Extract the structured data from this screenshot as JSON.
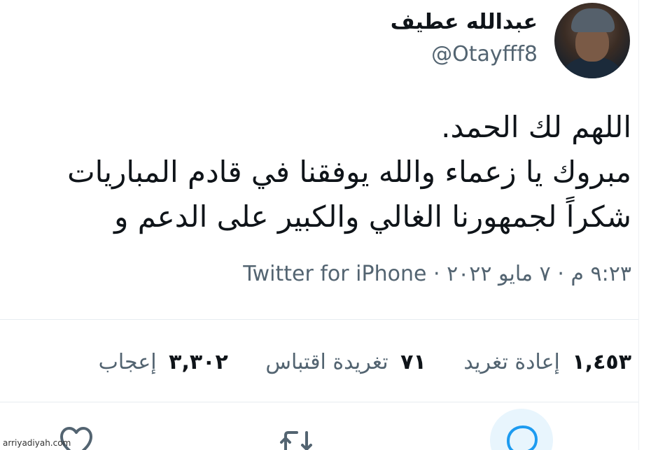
{
  "author": {
    "display_name": "عبدالله عطيف",
    "handle": "@Otayfff8"
  },
  "tweet": {
    "lines": [
      "اللهم لك الحمد.",
      "مبروك يا زعماء والله يوفقنا في قادم المباريات",
      "شكراً لجمهورنا الغالي والكبير على الدعم و"
    ]
  },
  "meta": {
    "time": "٩:٢٣ م",
    "separator": "·",
    "date": "٧ مايو ٢٠٢٢",
    "source": "Twitter for iPhone"
  },
  "stats": {
    "retweets": {
      "count": "١,٤٥٣",
      "label": "إعادة تغريد"
    },
    "quotes": {
      "count": "٧١",
      "label": "تغريدة اقتباس"
    },
    "likes": {
      "count": "٣,٣٠٢",
      "label": "إعجاب"
    }
  },
  "actions": {
    "reply_icon": "reply-icon",
    "retweet_icon": "retweet-icon",
    "like_icon": "heart-icon",
    "accent": "#1d9bf0"
  },
  "watermark": "arriyadiyah.com"
}
